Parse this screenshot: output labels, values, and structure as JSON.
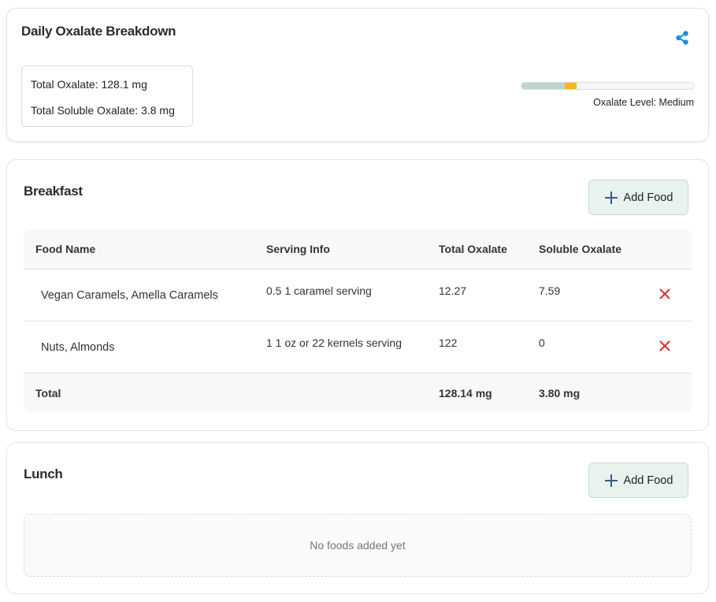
{
  "summary": {
    "title": "Daily Oxalate Breakdown",
    "total_oxalate": "Total Oxalate: 128.1 mg",
    "total_soluble": "Total Soluble Oxalate: 3.8 mg",
    "level_label": "Oxalate Level: Medium",
    "level_bar": {
      "low_fraction": 0.25,
      "medium_fraction": 0.07,
      "low_color": "#bcd6cd",
      "medium_color": "#f4b81b"
    },
    "share_icon": "share-icon",
    "accent_color": "#1a8fe3"
  },
  "breakfast": {
    "title": "Breakfast",
    "add_label": "Add Food",
    "columns": [
      "Food Name",
      "Serving Info",
      "Total Oxalate",
      "Soluble Oxalate"
    ],
    "rows": [
      {
        "name": "Vegan Caramels, Amella Caramels",
        "serving": "0.5 1 caramel serving",
        "total": "12.27",
        "soluble": "7.59"
      },
      {
        "name": "Nuts, Almonds",
        "serving": "1 1 oz or 22 kernels serving",
        "total": "122",
        "soluble": "0"
      }
    ],
    "footer": {
      "label": "Total",
      "total": "128.14 mg",
      "soluble": "3.80 mg"
    },
    "delete_color": "#d9302c"
  },
  "lunch": {
    "title": "Lunch",
    "add_label": "Add Food",
    "empty_text": "No foods added yet"
  }
}
